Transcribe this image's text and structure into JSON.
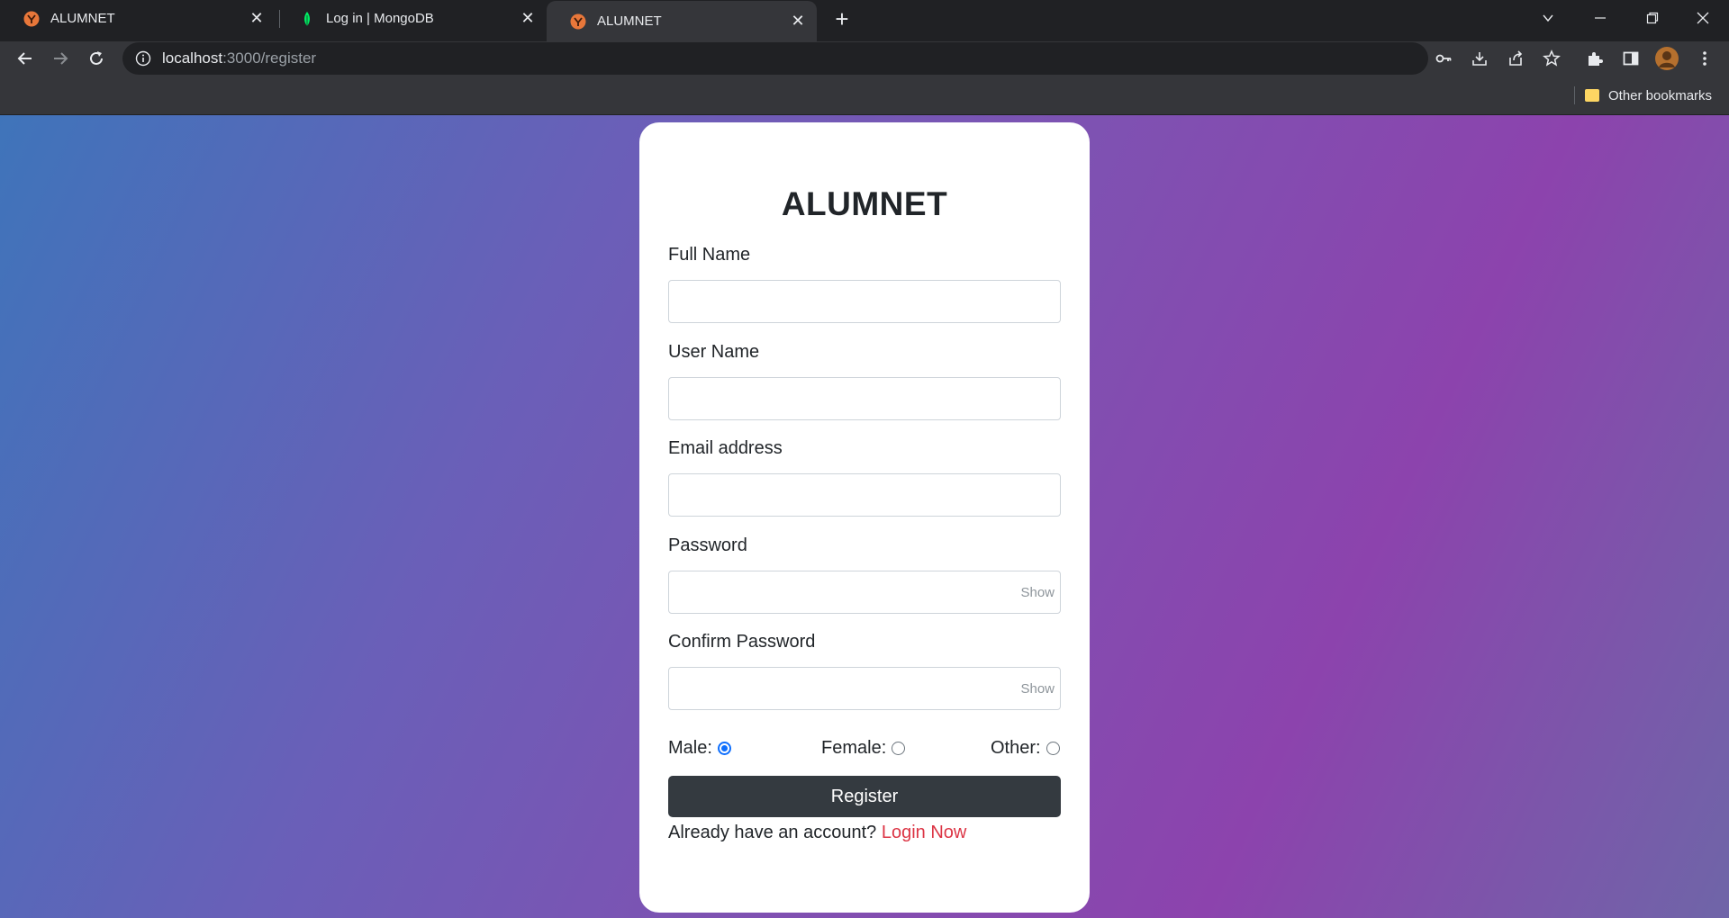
{
  "browser": {
    "tabs": [
      {
        "title": "ALUMNET",
        "icon": "alumnet-favicon"
      },
      {
        "title": "Log in | MongoDB",
        "icon": "mongodb-leaf-icon"
      },
      {
        "title": "ALUMNET",
        "icon": "alumnet-favicon",
        "active": true
      }
    ],
    "url_host": "localhost",
    "url_path": ":3000/register",
    "bookmarks": {
      "other_label": "Other bookmarks"
    }
  },
  "page": {
    "brand": "ALUMNET",
    "fields": [
      {
        "label": "Full Name",
        "value": "",
        "placeholder": ""
      },
      {
        "label": "User Name",
        "value": "",
        "placeholder": ""
      },
      {
        "label": "Email address",
        "value": "",
        "placeholder": ""
      },
      {
        "label": "Password",
        "value": "",
        "placeholder": "",
        "toggle": "Show"
      },
      {
        "label": "Confirm Password",
        "value": "",
        "placeholder": "",
        "toggle": "Show"
      }
    ],
    "gender": {
      "male": "Male:",
      "female": "Female:",
      "other": "Other:",
      "selected": "Male"
    },
    "register_label": "Register",
    "login_prompt": "Already have an account?",
    "login_link": "Login Now"
  },
  "colors": {
    "accent_button": "#343a40",
    "link": "#dc3545",
    "radio_selected": "#0d6efd"
  }
}
